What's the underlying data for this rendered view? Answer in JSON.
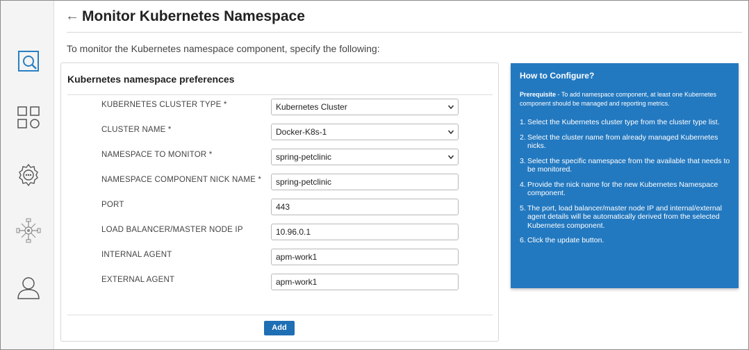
{
  "page": {
    "title": "Monitor Kubernetes Namespace",
    "back_label": "←",
    "intro": "To monitor the Kubernetes namespace component, specify the following:"
  },
  "sidebar": {
    "items": [
      {
        "name": "search-icon",
        "active": true
      },
      {
        "name": "apps-grid-icon",
        "active": false
      },
      {
        "name": "settings-gear-icon",
        "active": false
      },
      {
        "name": "network-icon",
        "active": false
      },
      {
        "name": "user-icon",
        "active": false
      }
    ]
  },
  "form": {
    "title": "Kubernetes namespace preferences",
    "fields": [
      {
        "label": "KUBERNETES CLUSTER TYPE *",
        "value": "Kubernetes Cluster",
        "type": "select"
      },
      {
        "label": "CLUSTER NAME *",
        "value": "Docker-K8s-1",
        "type": "select"
      },
      {
        "label": "NAMESPACE TO MONITOR *",
        "value": "spring-petclinic",
        "type": "select"
      },
      {
        "label": "NAMESPACE COMPONENT NICK NAME *",
        "value": "spring-petclinic",
        "type": "text"
      },
      {
        "label": "PORT",
        "value": "443",
        "type": "text"
      },
      {
        "label": "LOAD BALANCER/MASTER NODE IP",
        "value": "10.96.0.1",
        "type": "text"
      },
      {
        "label": "INTERNAL AGENT",
        "value": "apm-work1",
        "type": "text"
      },
      {
        "label": "EXTERNAL AGENT",
        "value": "apm-work1",
        "type": "text"
      }
    ],
    "add_label": "Add"
  },
  "help": {
    "title": "How to Configure?",
    "prereq_label": "Prerequisite",
    "prereq_text": " - To add namespace component, at least one Kubernetes component should be managed and reporting metrics.",
    "steps": [
      {
        "num": "1.",
        "text": "Select the Kubernetes cluster type from the cluster type list."
      },
      {
        "num": "2.",
        "text": "Select the cluster name from already managed Kubernetes nicks."
      },
      {
        "num": "3.",
        "text": "Select the specific namespace from the available that needs to be monitored."
      },
      {
        "num": "4.",
        "text": "Provide the nick name for the new Kubernetes Namespace component."
      },
      {
        "num": "5.",
        "text": "The port, load balancer/master node IP and internal/external agent details will be automatically derived from the selected Kubernetes component."
      },
      {
        "num": "6.",
        "text": "Click the update button."
      }
    ]
  },
  "colors": {
    "accent": "#1f6fb5",
    "help_bg": "#2379c0",
    "sidebar_active": "#2a7fc1",
    "sidebar_icon": "#555555"
  }
}
